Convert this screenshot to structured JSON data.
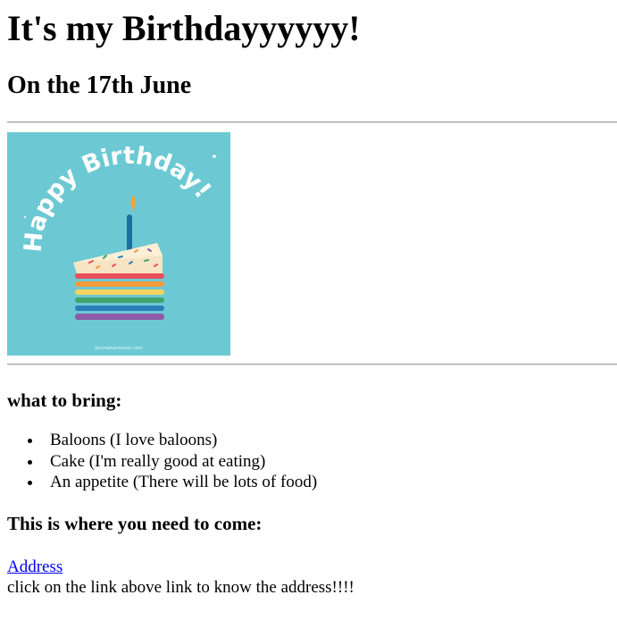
{
  "header": {
    "title": "It's my Birthdayyyyyy!",
    "date": "On the 17th June"
  },
  "image": {
    "banner_text": "Happy Birthday!",
    "footer_text": "byurasharmarsh.com",
    "colors": {
      "background": "#6cc9d3",
      "cake_top": "#f6e4c3",
      "stripes": [
        "#e8505b",
        "#f39a3c",
        "#f4d35e",
        "#3fa56b",
        "#2a7fb8",
        "#8e5aa8"
      ],
      "candle": "#1c6e9c",
      "flame": "#f2a33a"
    }
  },
  "bring": {
    "heading": "what to bring:",
    "items": [
      "Baloons (I love baloons)",
      "Cake (I'm really good at eating)",
      "An appetite (There will be lots of food)"
    ]
  },
  "location": {
    "heading": "This is where you need to come:",
    "link_label": "Address",
    "note": "click on the link above link to know the address!!!!"
  }
}
